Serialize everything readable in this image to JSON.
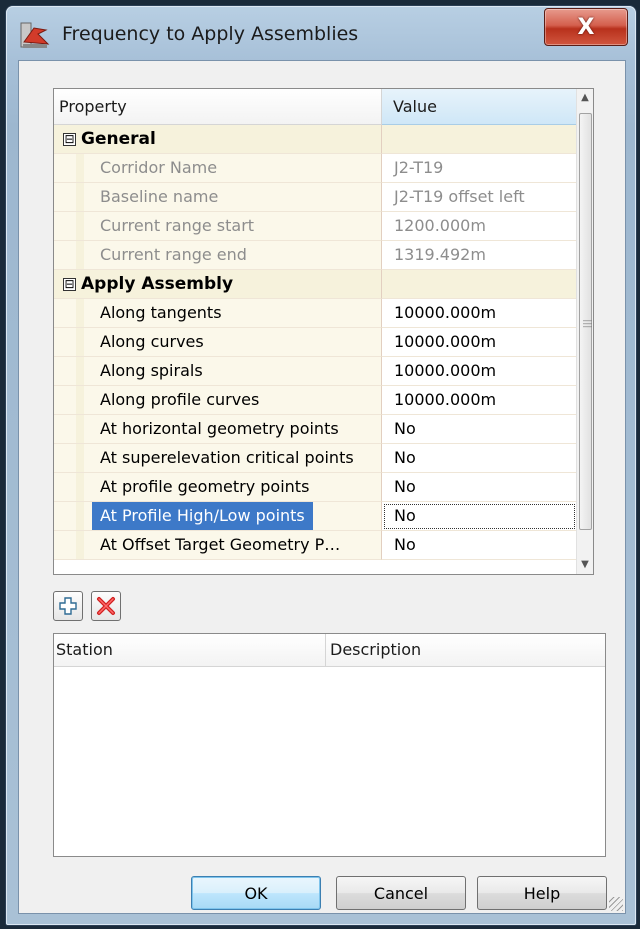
{
  "window": {
    "title": "Frequency to Apply Assemblies",
    "close_label": "X"
  },
  "grid": {
    "headers": {
      "property": "Property",
      "value": "Value"
    },
    "categories": [
      {
        "label": "General",
        "toggle": "⊟",
        "items": [
          {
            "label": "Corridor Name",
            "value": "J2-T19",
            "readonly": true
          },
          {
            "label": "Baseline name",
            "value": "J2-T19 offset left",
            "readonly": true
          },
          {
            "label": "Current range start",
            "value": "1200.000m",
            "readonly": true
          },
          {
            "label": "Current range end",
            "value": "1319.492m",
            "readonly": true
          }
        ]
      },
      {
        "label": "Apply Assembly",
        "toggle": "⊟",
        "items": [
          {
            "label": "Along tangents",
            "value": "10000.000m"
          },
          {
            "label": "Along curves",
            "value": "10000.000m"
          },
          {
            "label": "Along spirals",
            "value": "10000.000m"
          },
          {
            "label": "Along profile curves",
            "value": "10000.000m"
          },
          {
            "label": "At horizontal geometry points",
            "value": "No"
          },
          {
            "label": "At superelevation critical points",
            "value": "No"
          },
          {
            "label": "At profile geometry points",
            "value": "No"
          },
          {
            "label": "At Profile High/Low points",
            "value": "No",
            "selected": true
          },
          {
            "label": "At Offset Target Geometry P…",
            "value": "No"
          }
        ]
      }
    ]
  },
  "toolbar": {
    "add_icon": "add-icon",
    "delete_icon": "delete-icon"
  },
  "stations": {
    "headers": {
      "station": "Station",
      "description": "Description"
    },
    "rows": []
  },
  "buttons": {
    "ok": "OK",
    "cancel": "Cancel",
    "help": "Help"
  },
  "colors": {
    "selection": "#3d79c8",
    "category_bg": "#f6f2dc",
    "readonly_text": "#8d8d8d"
  }
}
